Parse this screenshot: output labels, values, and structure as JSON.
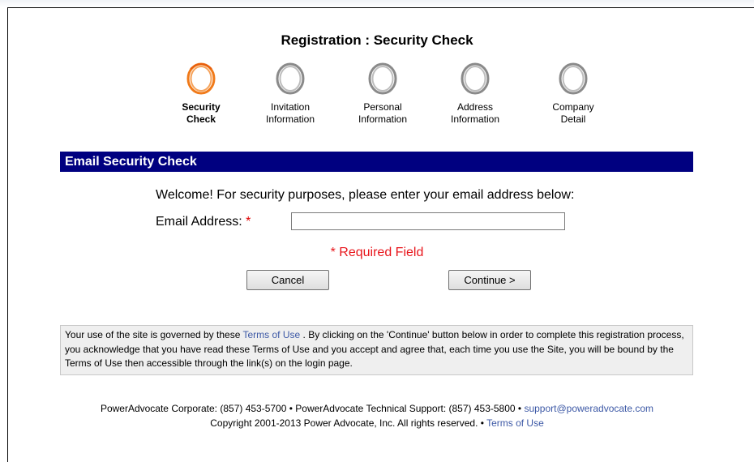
{
  "page": {
    "title": "Registration : Security Check"
  },
  "steps": [
    {
      "line1": "Security",
      "line2": "Check",
      "active": true
    },
    {
      "line1": "Invitation",
      "line2": "Information",
      "active": false
    },
    {
      "line1": "Personal",
      "line2": "Information",
      "active": false
    },
    {
      "line1": "Address",
      "line2": "Information",
      "active": false
    },
    {
      "line1": "Company",
      "line2": "Detail",
      "active": false
    }
  ],
  "section": {
    "header": "Email Security Check",
    "welcome": "Welcome! For security purposes, please enter your email address below:",
    "email_label": "Email Address:",
    "required_star": "*",
    "email_value": "",
    "required_note": "* Required Field"
  },
  "buttons": {
    "cancel": "Cancel",
    "continue": "Continue >"
  },
  "terms": {
    "intro": "Your use of the site is governed by these",
    "link": "Terms of Use",
    "body": ". By clicking on the 'Continue' button below in order to complete this registration process, you acknowledge that you have read these Terms of Use and you accept and agree that, each time you use the Site, you will be bound by the Terms of Use then accessible through the link(s) on the login page."
  },
  "footer": {
    "corporate": "PowerAdvocate Corporate: (857) 453-5700 • PowerAdvocate Technical Support: (857) 453-5800 •",
    "email": "support@poweradvocate.com",
    "copyright": "Copyright 2001-2013 Power Advocate, Inc. All rights reserved. •",
    "terms_link": "Terms of Use"
  },
  "colors": {
    "header_bg": "#000080",
    "active_ring": "#f07a1a",
    "inactive_ring": "#8a8a8a",
    "required": "#e8151b",
    "link": "#3d59a6"
  },
  "icons": {
    "active_step": "orange-ring-icon",
    "inactive_step": "gray-ring-icon"
  }
}
